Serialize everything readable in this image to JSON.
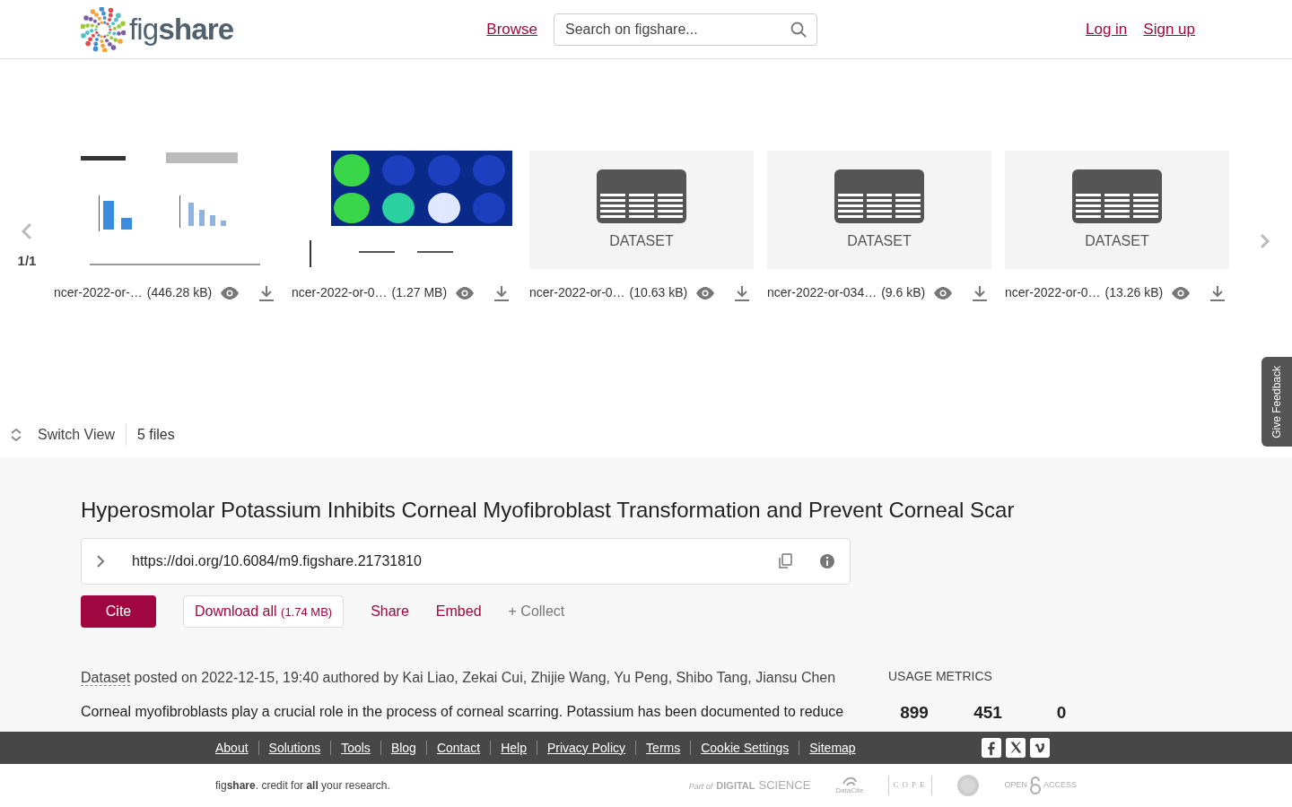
{
  "header": {
    "logo": "fig**share**",
    "nav_link": "Browse",
    "search": {
      "placeholder": "Search on figshare..."
    },
    "auth_links": [
      "Log in",
      "Sign up"
    ]
  },
  "carousel": {
    "counter": "1/1",
    "files": [
      {
        "kind": "picture",
        "name": "ncer-2022-or-…",
        "size": "(446.28 kB)"
      },
      {
        "kind": "picture",
        "name": "ncer-2022-or-0…",
        "size": "(1.27 MB)"
      },
      {
        "kind": "dataset",
        "label": "DATASET",
        "name": "ncer-2022-or-0…",
        "size": "(10.63 kB)"
      },
      {
        "kind": "dataset",
        "label": "DATASET",
        "name": "ncer-2022-or-034…",
        "size": "(9.6 kB)"
      },
      {
        "kind": "dataset",
        "label": "DATASET",
        "name": "ncer-2022-or-0…",
        "size": "(13.26 kB)"
      }
    ]
  },
  "feedback_tab": "Give Feedback",
  "view_bar": {
    "switch_view": "Switch View",
    "file_count": "5 files"
  },
  "item": {
    "title": "Hyperosmolar Potassium Inhibits Corneal Myofibroblast Transformation and Prevent Corneal Scar",
    "doi": "https://doi.org/10.6084/m9.figshare.21731810",
    "actions": {
      "cite": "Cite",
      "download": "Download all",
      "download_size": "(1.74 MB)",
      "share": "Share",
      "embed": "Embed",
      "collect": "+ Collect"
    },
    "type_link": "Dataset",
    "posted": "posted on 2022-12-15, 19:40 authored by Kai Liao, Zekai Cui, Zhijie Wang, Yu Peng, Shibo Tang, Jiansu Chen",
    "description": "Corneal myofibroblasts play a crucial role in the process of corneal scarring. Potassium has been documented to reduce"
  },
  "metrics": {
    "heading": "USAGE METRICS",
    "values": [
      "899",
      "451",
      "0"
    ]
  },
  "footer": {
    "links": [
      "About",
      "Solutions",
      "Tools",
      "Blog",
      "Contact",
      "Help",
      "Privacy Policy",
      "Terms",
      "Cookie Settings",
      "Sitemap"
    ],
    "social": [
      {
        "kind": "facebook"
      },
      {
        "kind": "x"
      },
      {
        "kind": "vimeo"
      }
    ],
    "tagline": "fig**share**. credit for **all** your research.",
    "partners": [
      {
        "kind": "digital-science",
        "texts": [
          "Part of",
          "DIGITAL",
          "SCIENCE"
        ]
      },
      {
        "kind": "datacite",
        "texts": [
          "DataCite"
        ]
      },
      {
        "kind": "cope",
        "texts": [
          "COPE"
        ]
      },
      {
        "kind": "seal"
      },
      {
        "kind": "open-access",
        "texts": [
          "OPEN",
          "ACCESS"
        ]
      }
    ]
  }
}
